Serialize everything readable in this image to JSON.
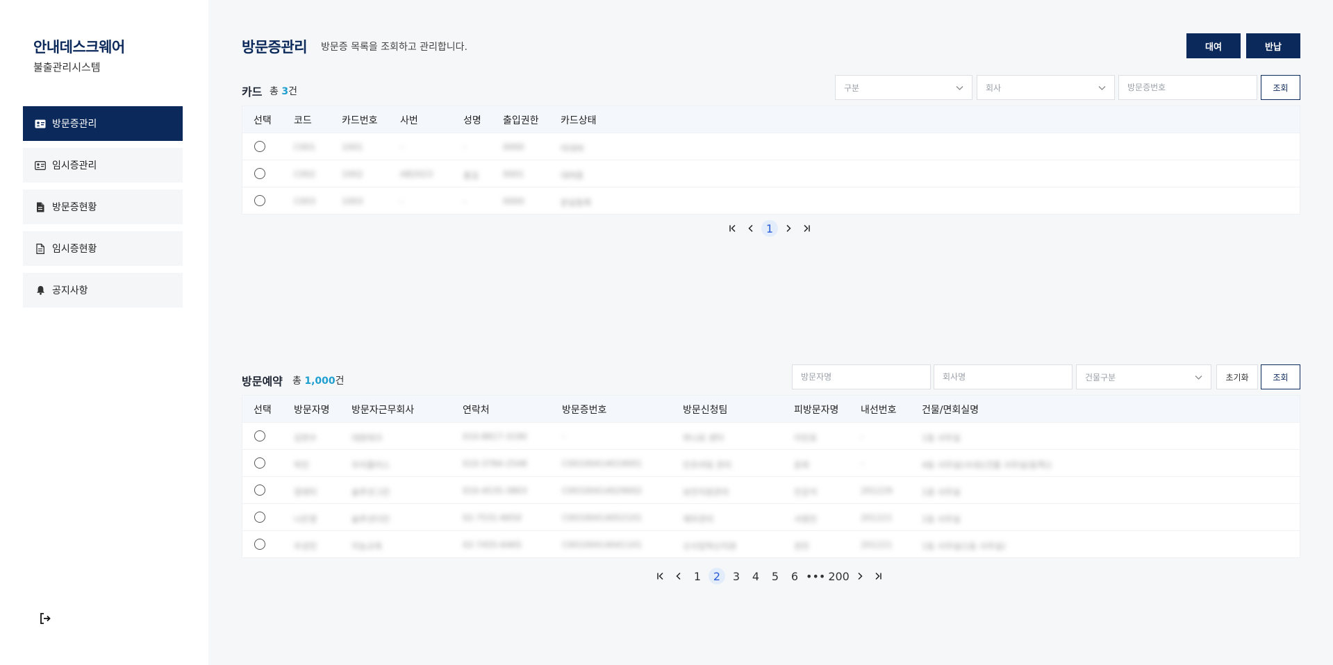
{
  "sidebar": {
    "brand_title": "안내데스크웨어",
    "brand_sub": "불출관리시스템",
    "items": [
      {
        "label": "방문증관리"
      },
      {
        "label": "임시증관리"
      },
      {
        "label": "방문증현황"
      },
      {
        "label": "임시증현황"
      },
      {
        "label": "공지사항"
      }
    ]
  },
  "header": {
    "title": "방문증관리",
    "desc": "방문증 목록을 조회하고 관리합니다.",
    "rent_label": "대여",
    "return_label": "반납"
  },
  "card": {
    "title": "카드",
    "count_prefix": "총 ",
    "count": "3",
    "count_suffix": "건",
    "filter_type": "구분",
    "filter_company": "회사",
    "search_placeholder": "방문증번호",
    "search_label": "조회",
    "columns": [
      "선택",
      "코드",
      "카드번호",
      "사번",
      "성명",
      "출입권한",
      "카드상태"
    ],
    "rows": [
      [
        "C001",
        "1001",
        "-",
        "-",
        "0000",
        "미대여"
      ],
      [
        "C002",
        "1002",
        "AB2023",
        "홍길",
        "0001",
        "대여중"
      ],
      [
        "C003",
        "1003",
        "-",
        "-",
        "0000",
        "분실등록"
      ]
    ],
    "pages": [
      "1"
    ],
    "current_page": "1"
  },
  "reservation": {
    "title": "방문예약",
    "count_prefix": "총 ",
    "count": "1,000",
    "count_suffix": "건",
    "visitor_placeholder": "방문자명",
    "company_placeholder": "회사명",
    "building_select": "건물구분",
    "reset_label": "초기화",
    "search_label": "조회",
    "columns": [
      "선택",
      "방문자명",
      "방문자근무회사",
      "연락처",
      "방문증번호",
      "방문신청팀",
      "피방문자명",
      "내선번호",
      "건물/면회실명"
    ],
    "rows": [
      [
        "김현수",
        "대원테크",
        "010-8817-3190",
        "-",
        "하나로 센터",
        "이민호",
        "-",
        "1동 사무실"
      ],
      [
        "박진",
        "우리플러스",
        "010-3784-2548",
        "C00100414019001",
        "인프라팀 관리",
        "윤희",
        "-",
        "4동 사무실(사내)(건물 사무실(동쪽))"
      ],
      [
        "정태미",
        "솔루션그린",
        "010-4535-3803",
        "C00100414029002",
        "보안지원관리",
        "진강석",
        "201229",
        "1층 사무실"
      ],
      [
        "나은영",
        "솔루션다인",
        "02-7531-6650",
        "C00100414052101",
        "재무관리",
        "서영진",
        "201221",
        "1동 사무실"
      ],
      [
        "우성민",
        "지능교육",
        "02-7455-6465",
        "C00100414041101",
        "신사업혁신지원",
        "권진",
        "201221",
        "1동 사무실(1동 사무실)"
      ]
    ],
    "pages": [
      "1",
      "2",
      "3",
      "4",
      "5",
      "6",
      "•••",
      "200"
    ],
    "current_page": "2"
  }
}
